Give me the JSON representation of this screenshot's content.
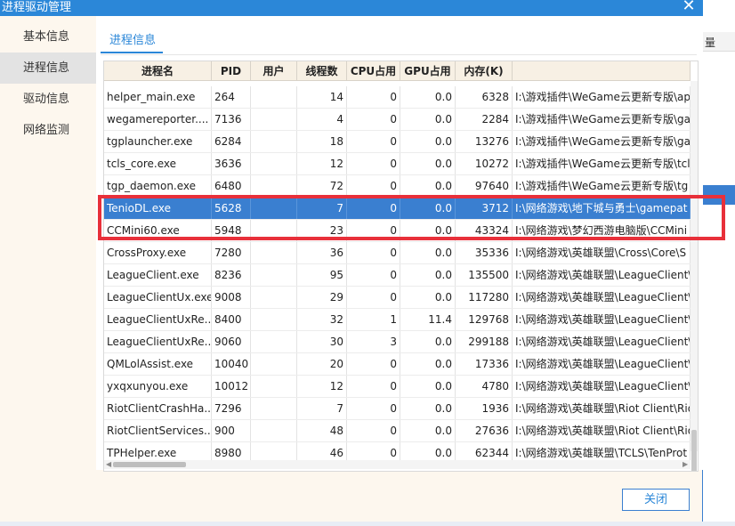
{
  "window": {
    "title": "进程驱动管理"
  },
  "background": {
    "column_header": "量"
  },
  "sidebar": {
    "items": [
      {
        "label": "基本信息",
        "active": false
      },
      {
        "label": "进程信息",
        "active": true
      },
      {
        "label": "驱动信息",
        "active": false
      },
      {
        "label": "网络监测",
        "active": false
      }
    ]
  },
  "tab": {
    "label": "进程信息"
  },
  "table": {
    "columns": [
      "进程名",
      "PID",
      "用户",
      "线程数",
      "CPU占用",
      "GPU占用",
      "内存(K)",
      ""
    ],
    "rows": [
      {
        "name": "helper_main.exe",
        "pid": "264",
        "user": "",
        "threads": "14",
        "cpu": "0",
        "gpu": "0.0",
        "mem": "6328",
        "path": "I:\\游戏插件\\WeGame云更新专版\\app",
        "selected": false
      },
      {
        "name": "wegamereporter....",
        "pid": "7136",
        "user": "",
        "threads": "4",
        "cpu": "0",
        "gpu": "0.0",
        "mem": "2284",
        "path": "I:\\游戏插件\\WeGame云更新专版\\ga",
        "selected": false
      },
      {
        "name": "tgplauncher.exe",
        "pid": "6284",
        "user": "",
        "threads": "18",
        "cpu": "0",
        "gpu": "0.0",
        "mem": "13276",
        "path": "I:\\游戏插件\\WeGame云更新专版\\ga",
        "selected": false
      },
      {
        "name": "tcls_core.exe",
        "pid": "3636",
        "user": "",
        "threads": "12",
        "cpu": "0",
        "gpu": "0.0",
        "mem": "10272",
        "path": "I:\\游戏插件\\WeGame云更新专版\\tcl",
        "selected": false
      },
      {
        "name": "tgp_daemon.exe",
        "pid": "6480",
        "user": "",
        "threads": "72",
        "cpu": "0",
        "gpu": "0.0",
        "mem": "97640",
        "path": "I:\\游戏插件\\WeGame云更新专版\\tg",
        "selected": false
      },
      {
        "name": "TenioDL.exe",
        "pid": "5628",
        "user": "",
        "threads": "7",
        "cpu": "0",
        "gpu": "0.0",
        "mem": "3712",
        "path": "I:\\网络游戏\\地下城与勇士\\gamepat",
        "selected": true
      },
      {
        "name": "CCMini60.exe",
        "pid": "5948",
        "user": "",
        "threads": "23",
        "cpu": "0",
        "gpu": "0.0",
        "mem": "43324",
        "path": "I:\\网络游戏\\梦幻西游电脑版\\CCMini",
        "selected": false
      },
      {
        "name": "CrossProxy.exe",
        "pid": "7280",
        "user": "",
        "threads": "36",
        "cpu": "0",
        "gpu": "0.0",
        "mem": "35336",
        "path": "I:\\网络游戏\\英雄联盟\\Cross\\Core\\S",
        "selected": false
      },
      {
        "name": "LeagueClient.exe",
        "pid": "8236",
        "user": "",
        "threads": "95",
        "cpu": "0",
        "gpu": "0.0",
        "mem": "135500",
        "path": "I:\\网络游戏\\英雄联盟\\LeagueClient\\",
        "selected": false
      },
      {
        "name": "LeagueClientUx.exe",
        "pid": "9008",
        "user": "",
        "threads": "29",
        "cpu": "0",
        "gpu": "0.0",
        "mem": "117280",
        "path": "I:\\网络游戏\\英雄联盟\\LeagueClient\\",
        "selected": false
      },
      {
        "name": "LeagueClientUxRe...",
        "pid": "8400",
        "user": "",
        "threads": "32",
        "cpu": "1",
        "gpu": "11.4",
        "mem": "129768",
        "path": "I:\\网络游戏\\英雄联盟\\LeagueClient\\",
        "selected": false
      },
      {
        "name": "LeagueClientUxRe...",
        "pid": "9060",
        "user": "",
        "threads": "30",
        "cpu": "3",
        "gpu": "0.0",
        "mem": "299188",
        "path": "I:\\网络游戏\\英雄联盟\\LeagueClient\\",
        "selected": false
      },
      {
        "name": "QMLolAssist.exe",
        "pid": "10040",
        "user": "",
        "threads": "20",
        "cpu": "0",
        "gpu": "0.0",
        "mem": "17336",
        "path": "I:\\网络游戏\\英雄联盟\\LeagueClient\\",
        "selected": false
      },
      {
        "name": "yxqxunyou.exe",
        "pid": "10012",
        "user": "",
        "threads": "12",
        "cpu": "0",
        "gpu": "0.0",
        "mem": "4780",
        "path": "I:\\网络游戏\\英雄联盟\\LeagueClient\\",
        "selected": false
      },
      {
        "name": "RiotClientCrashHa...",
        "pid": "7296",
        "user": "",
        "threads": "7",
        "cpu": "0",
        "gpu": "0.0",
        "mem": "1936",
        "path": "I:\\网络游戏\\英雄联盟\\Riot Client\\Rio",
        "selected": false
      },
      {
        "name": "RiotClientServices....",
        "pid": "900",
        "user": "",
        "threads": "48",
        "cpu": "0",
        "gpu": "0.0",
        "mem": "27636",
        "path": "I:\\网络游戏\\英雄联盟\\Riot Client\\Rio",
        "selected": false
      },
      {
        "name": "TPHelper.exe",
        "pid": "8980",
        "user": "",
        "threads": "46",
        "cpu": "0",
        "gpu": "0.0",
        "mem": "62344",
        "path": "I:\\网络游戏\\英雄联盟\\TCLS\\TenProt",
        "selected": false
      }
    ]
  },
  "footer": {
    "close_label": "关闭"
  },
  "colors": {
    "accent": "#2b87d8",
    "selection": "#3a7fd0",
    "highlight": "#e8303a"
  }
}
